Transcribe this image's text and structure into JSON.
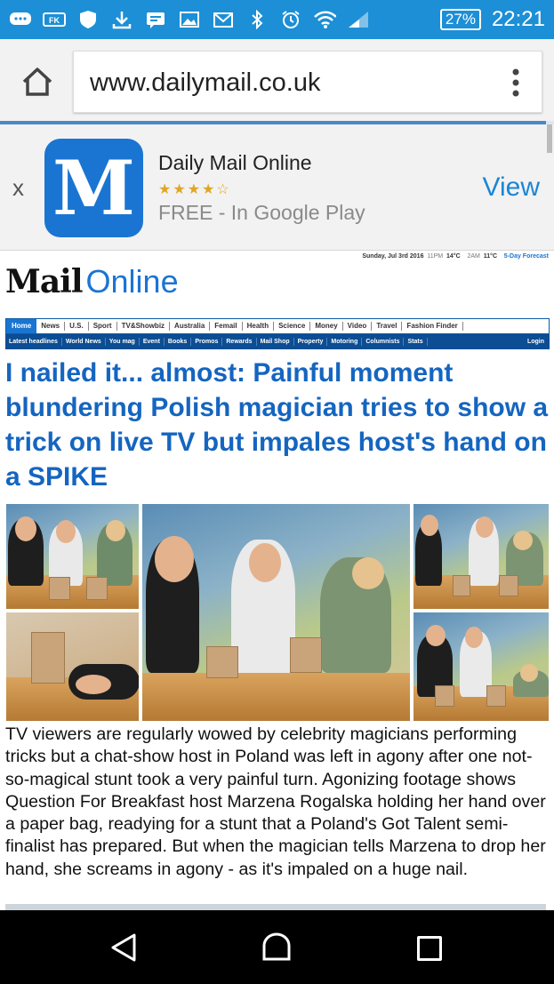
{
  "status_bar": {
    "battery": "27%",
    "time": "22:21",
    "icons": [
      "chat-icon",
      "fk-icon",
      "shield-icon",
      "download-icon",
      "message-icon",
      "image-icon",
      "gmail-icon",
      "bluetooth-icon",
      "alarm-icon",
      "wifi-icon",
      "signal-icon"
    ]
  },
  "browser": {
    "url": "www.dailymail.co.uk",
    "load_progress": 0.985
  },
  "app_banner": {
    "close": "x",
    "icon_letter": "M",
    "app_name": "Daily Mail Online",
    "stars": "★★★★☆",
    "rating": 4.5,
    "price_store": "FREE - In Google Play",
    "view_label": "View"
  },
  "site": {
    "dateline": {
      "date": "Sunday, Jul 3rd 2016",
      "t1": "11PM",
      "temp1": "14°C",
      "t2": "2AM",
      "temp2": "11°C",
      "forecast": "5-Day Forecast"
    },
    "logo_mail": "Mail",
    "logo_online": "Online",
    "nav_primary": [
      "Home",
      "News",
      "U.S.",
      "Sport",
      "TV&Showbiz",
      "Australia",
      "Femail",
      "Health",
      "Science",
      "Money",
      "Video",
      "Travel",
      "Fashion Finder"
    ],
    "nav_secondary": [
      "Latest headlines",
      "World News",
      "You mag",
      "Event",
      "Books",
      "Promos",
      "Rewards",
      "Mail Shop",
      "Property",
      "Motoring",
      "Columnists",
      "Stats"
    ],
    "login": "Login"
  },
  "article": {
    "headline": "I nailed it... almost: Painful moment blundering Polish magician tries to show a trick on live TV but impales host's hand on a SPIKE",
    "body": "TV viewers are regularly wowed by celebrity magicians performing tricks but a chat-show host in Poland was left in agony after one not-so-magical stunt took a very painful turn. Agonizing footage shows Question For Breakfast host Marzena Rogalska holding her hand over a paper bag, readying for a stunt that a Poland's Got Talent semi-finalist has prepared. But when the magician tells Marzena to drop her hand, she screams in agony - as it's impaled on a huge nail."
  },
  "colors": {
    "status_bar": "#1c8fd6",
    "headline_blue": "#1565c0",
    "nav_dark": "#0c4d93",
    "app_icon": "#1a75d2",
    "view_link": "#1a86d6"
  }
}
